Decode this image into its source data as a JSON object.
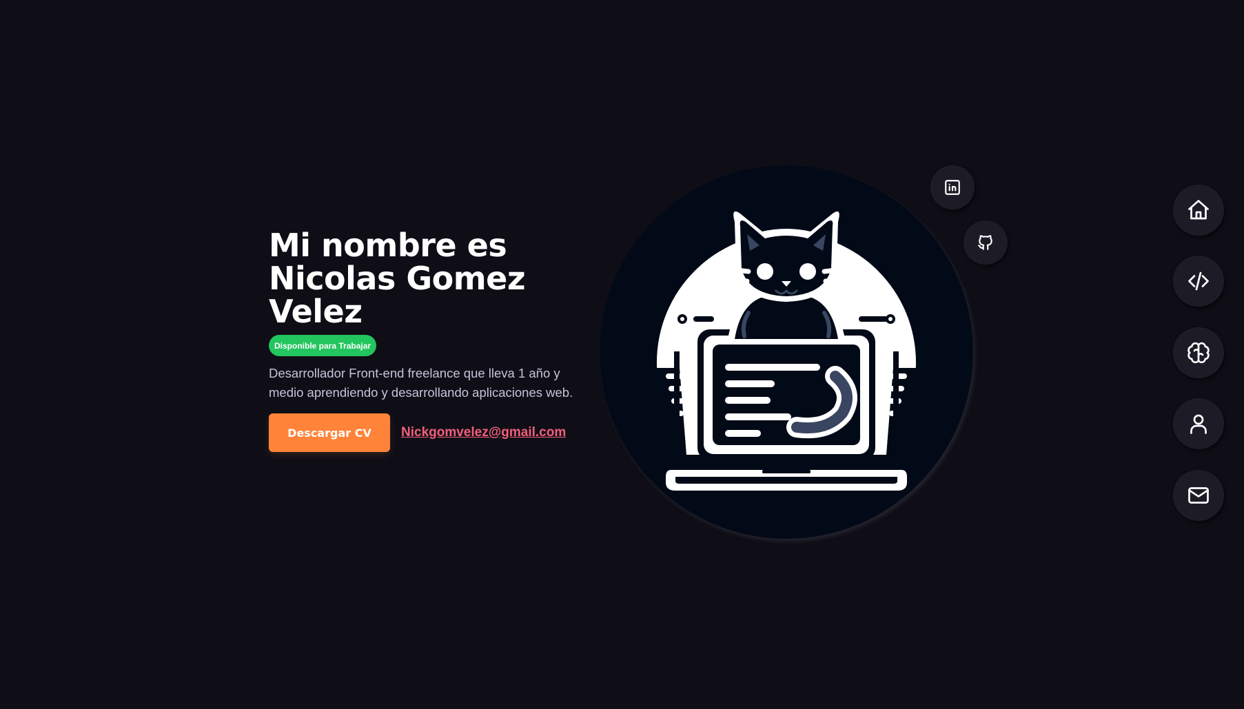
{
  "hero": {
    "title": "Mi nombre es Nicolas Gomez Velez",
    "badge": "Disponible para Trabajar",
    "description": "Desarrollador Front-end freelance que lleva 1 año y medio aprendiendo y desarrollando aplicaciones web.",
    "cv_button": "Descargar CV",
    "email": "Nickgomvelez@gmail.com"
  },
  "social": [
    {
      "name": "linkedin",
      "icon": "linkedin-icon"
    },
    {
      "name": "github",
      "icon": "github-icon"
    }
  ],
  "nav": [
    {
      "name": "home",
      "icon": "home-icon"
    },
    {
      "name": "projects",
      "icon": "code-icon"
    },
    {
      "name": "skills",
      "icon": "brain-icon"
    },
    {
      "name": "about",
      "icon": "user-icon"
    },
    {
      "name": "contact",
      "icon": "mail-icon"
    }
  ],
  "colors": {
    "background": "#0f0e17",
    "accent_orange": "#ff8338",
    "badge_green": "#22c55e",
    "link_pink": "#f25f7a",
    "button_surface": "#1c1b26"
  }
}
